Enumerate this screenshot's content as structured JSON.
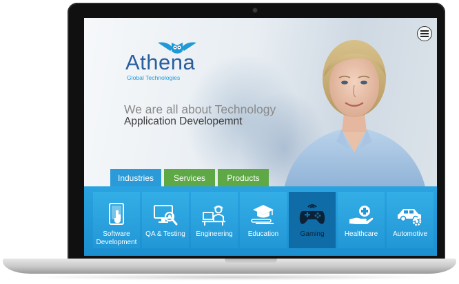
{
  "logo": {
    "name": "Athena",
    "tagline": "Global Technologies"
  },
  "hero": {
    "headline": "We are all about Technology",
    "subheadline": "Application Developemnt"
  },
  "menu": {
    "icon": "hamburger-icon"
  },
  "tabs": [
    {
      "label": "Industries",
      "active": true
    },
    {
      "label": "Services",
      "active": false
    },
    {
      "label": "Products",
      "active": false
    }
  ],
  "industries": [
    {
      "label": "Software\nDevelopment",
      "icon": "tablet-touch-icon",
      "selected": false
    },
    {
      "label": "QA & Testing",
      "icon": "monitor-bug-icon",
      "selected": false
    },
    {
      "label": "Engineering",
      "icon": "engineer-desk-icon",
      "selected": false
    },
    {
      "label": "Education",
      "icon": "graduation-cap-icon",
      "selected": false
    },
    {
      "label": "Gaming",
      "icon": "gamepad-icon",
      "selected": true
    },
    {
      "label": "Healthcare",
      "icon": "hand-medical-cross-icon",
      "selected": false
    },
    {
      "label": "Automotive",
      "icon": "car-gear-icon",
      "selected": false
    }
  ],
  "colors": {
    "accent_blue": "#2a9ad8",
    "accent_green": "#5ea846",
    "selected_tile": "#106ca6",
    "logo_blue": "#2a5f9e"
  }
}
